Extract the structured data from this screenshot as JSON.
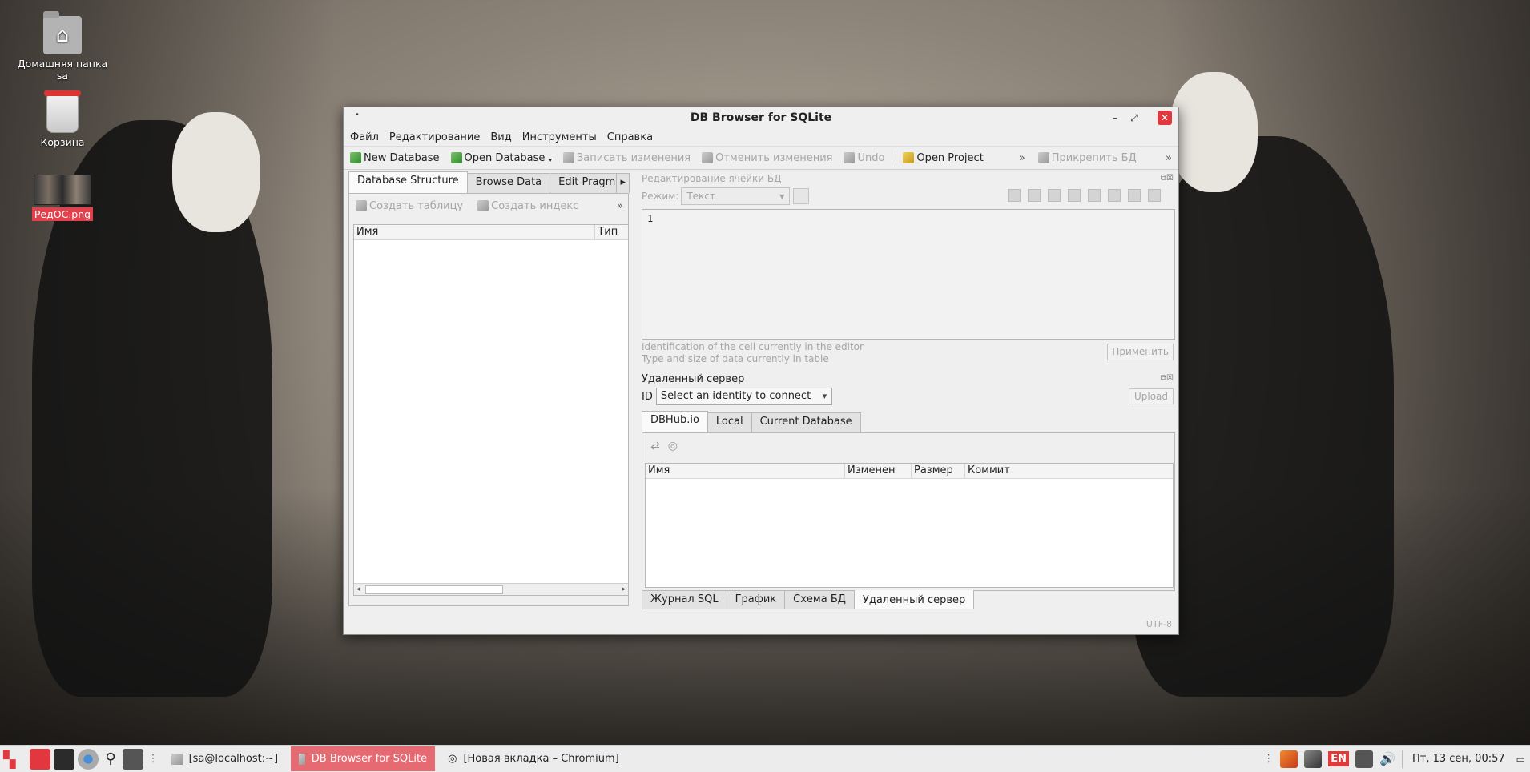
{
  "desktop": {
    "icons": [
      {
        "label": "Домашняя папка sa"
      },
      {
        "label": "Корзина"
      },
      {
        "label": "РедОС.png"
      }
    ]
  },
  "window": {
    "title": "DB Browser for SQLite",
    "menu": [
      "Файл",
      "Редактирование",
      "Вид",
      "Инструменты",
      "Справка"
    ],
    "toolbar": {
      "new_db": "New Database",
      "open_db": "Open Database",
      "write_changes": "Записать изменения",
      "revert_changes": "Отменить изменения",
      "undo": "Undo",
      "open_project": "Open Project",
      "attach_db": "Прикрепить БД"
    },
    "left": {
      "tabs": [
        "Database Structure",
        "Browse Data",
        "Edit Pragma"
      ],
      "create_table": "Создать таблицу",
      "create_index": "Создать индекс",
      "col_name": "Имя",
      "col_type": "Тип"
    },
    "editor": {
      "header": "Редактирование ячейки БД",
      "mode_label": "Режим:",
      "mode_value": "Текст",
      "content": "1",
      "info_line1": "Identification of the cell currently in the editor",
      "info_line2": "Type and size of data currently in table",
      "apply": "Применить"
    },
    "remote": {
      "header": "Удаленный сервер",
      "id_label": "ID",
      "identity_placeholder": "Select an identity to connect",
      "upload": "Upload",
      "tabs": [
        "DBHub.io",
        "Local",
        "Current Database"
      ],
      "columns": [
        "Имя",
        "Изменен",
        "Размер",
        "Коммит"
      ]
    },
    "bottom_tabs": [
      "Журнал SQL",
      "График",
      "Схема БД",
      "Удаленный сервер"
    ],
    "encoding": "UTF-8"
  },
  "taskbar": {
    "tasks": [
      "[sa@localhost:~]",
      "DB Browser for SQLite",
      "[Новая вкладка – Chromium]"
    ],
    "keyboard": "EN",
    "clock": "Пт, 13 сен, 00:57"
  },
  "colors": {
    "accent": "#e66a72",
    "close": "#e0383e"
  }
}
